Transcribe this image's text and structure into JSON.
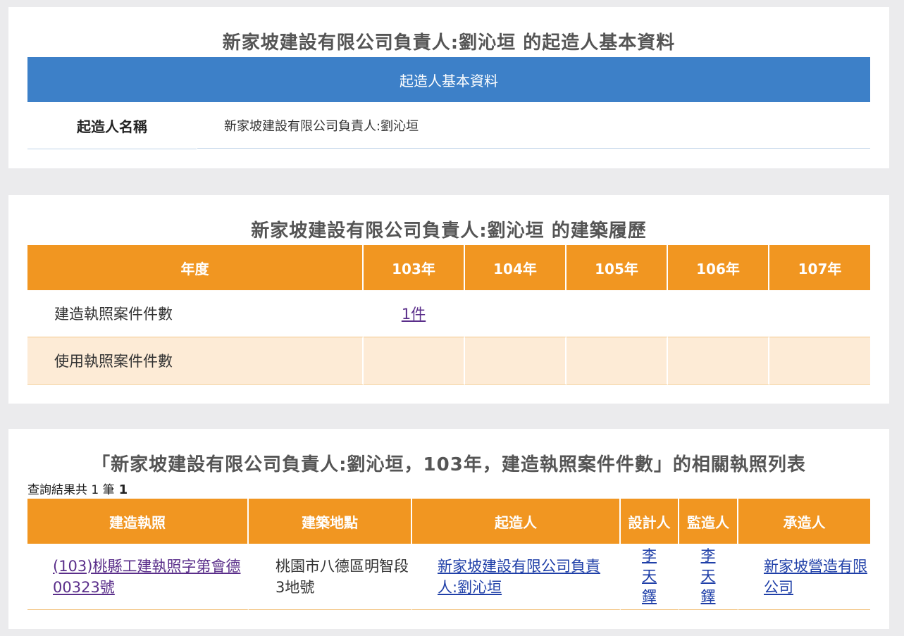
{
  "basic": {
    "title": "新家坡建設有限公司負責人:劉沁垣 的起造人基本資料",
    "bar_label": "起造人基本資料",
    "name_label": "起造人名稱",
    "name_value": "新家坡建設有限公司負責人:劉沁垣"
  },
  "history": {
    "title": "新家坡建設有限公司負責人:劉沁垣 的建築履歷",
    "headers": [
      "年度",
      "103年",
      "104年",
      "105年",
      "106年",
      "107年"
    ],
    "rows": [
      {
        "label": "建造執照案件件數",
        "cells": [
          "1件",
          "",
          "",
          "",
          ""
        ]
      },
      {
        "label": "使用執照案件件數",
        "cells": [
          "",
          "",
          "",
          "",
          ""
        ]
      }
    ]
  },
  "list": {
    "title": "「新家坡建設有限公司負責人:劉沁垣，103年，建造執照案件件數」的相關執照列表",
    "result_prefix": "查詢結果共 1 筆",
    "result_count": "1",
    "headers": [
      "建造執照",
      "建築地點",
      "起造人",
      "設計人",
      "監造人",
      "承造人"
    ],
    "rows": [
      {
        "permit": "(103)桃縣工建執照字第會德00323號",
        "address": "桃園市八德區明智段3地號",
        "owner": "新家坡建設有限公司負責人:劉沁垣",
        "designer": "李天鐸",
        "supervisor": "李天鐸",
        "contractor": "新家坡營造有限公司"
      }
    ]
  },
  "colors": {
    "blue_bar": "#3d80c8",
    "orange_header": "#f19621",
    "alt_row": "#fdebd6",
    "page_bg": "#ebebed"
  }
}
